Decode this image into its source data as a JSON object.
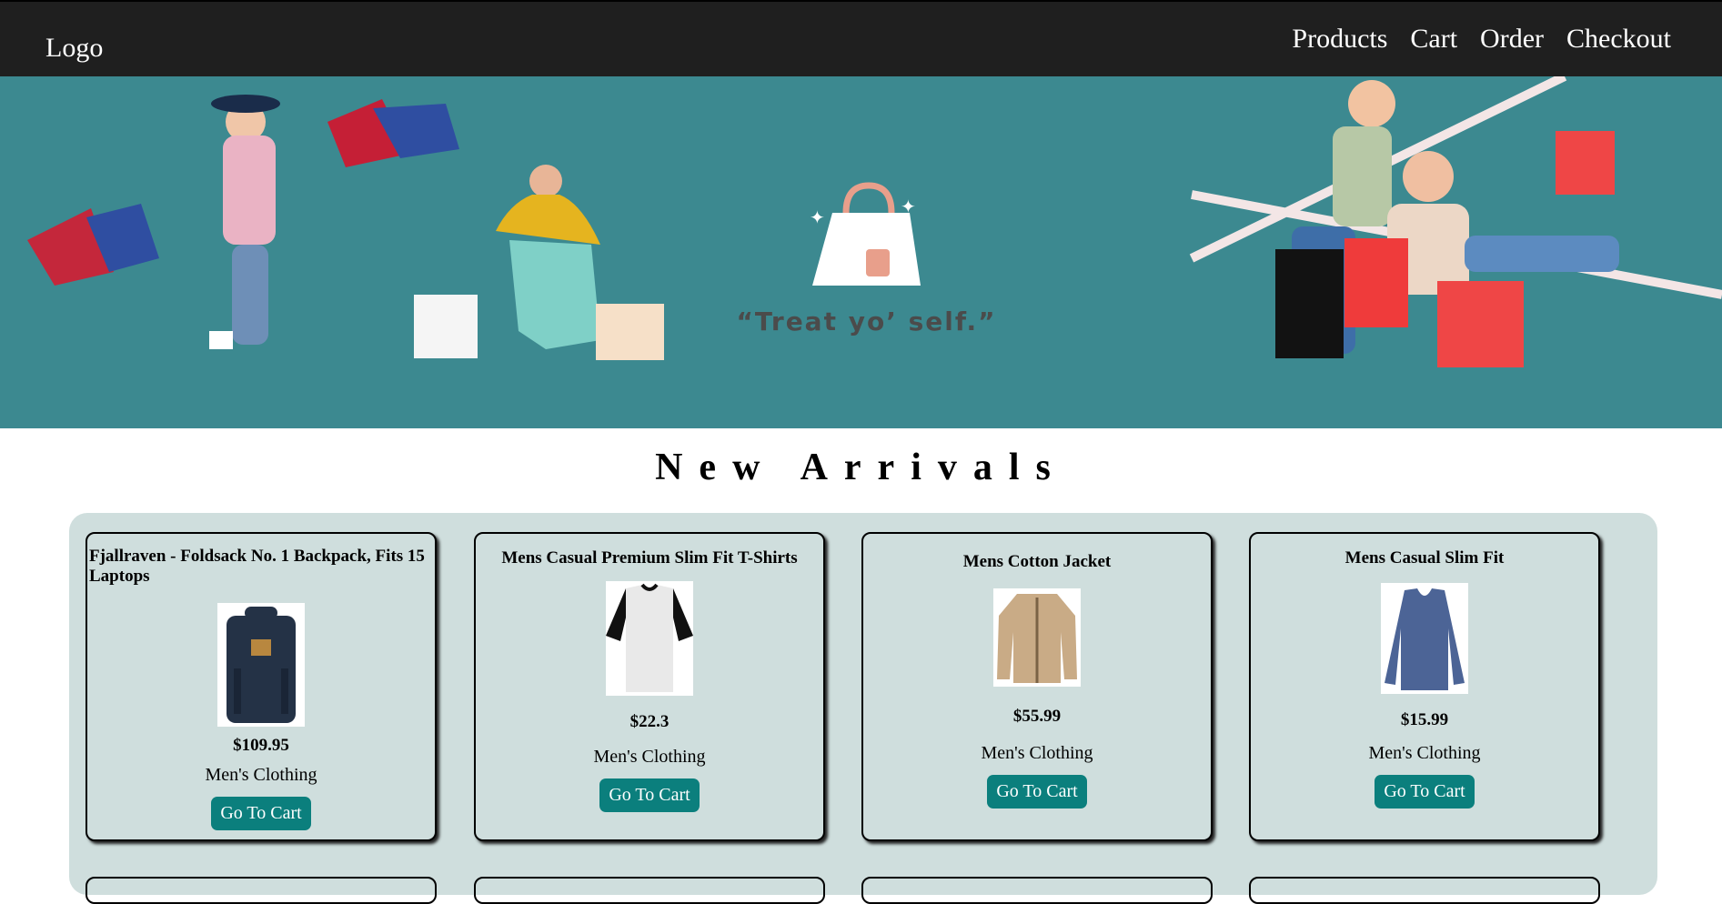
{
  "header": {
    "logo": "Logo",
    "nav": [
      "Products",
      "Cart",
      "Order",
      "Checkout"
    ]
  },
  "hero": {
    "quote": "“Treat yo’ self.”"
  },
  "section": {
    "title": "New Arrivals"
  },
  "products": [
    {
      "title": "Fjallraven - Foldsack No. 1 Backpack, Fits 15 Laptops",
      "price": "$109.95",
      "category": "Men's Clothing",
      "button": "Go To Cart",
      "icon": "backpack-icon"
    },
    {
      "title": "Mens Casual Premium Slim Fit T-Shirts",
      "price": "$22.3",
      "category": "Men's Clothing",
      "button": "Go To Cart",
      "icon": "tshirt-icon"
    },
    {
      "title": "Mens Cotton Jacket",
      "price": "$55.99",
      "category": "Men's Clothing",
      "button": "Go To Cart",
      "icon": "jacket-icon"
    },
    {
      "title": "Mens Casual Slim Fit",
      "price": "$15.99",
      "category": "Men's Clothing",
      "button": "Go To Cart",
      "icon": "longsleeve-icon"
    }
  ],
  "colors": {
    "header": "#1f1f1f",
    "hero": "#3c8990",
    "panel": "#cfdedd",
    "button": "#0b7f7d"
  }
}
